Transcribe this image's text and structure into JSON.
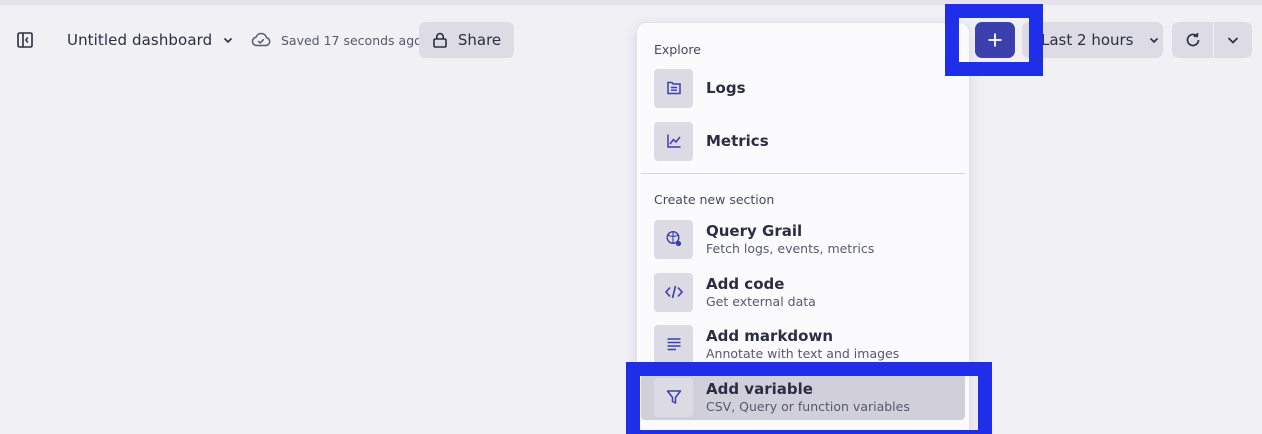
{
  "header": {
    "title": "Untitled dashboard",
    "saved_status": "Saved 17 seconds ago",
    "share_label": "Share",
    "timeframe_label": "Last 2 hours",
    "icons": {
      "sidebar_toggle": "sidebar-toggle-icon",
      "title_chevron": "chevron-down-icon",
      "saved": "cloud-check-icon",
      "share": "lock-icon",
      "add": "plus-icon",
      "timeframe_chevron": "chevron-down-icon",
      "refresh": "refresh-icon",
      "refresh_menu": "chevron-down-icon"
    }
  },
  "menu": {
    "explore_title": "Explore",
    "explore_items": [
      {
        "label": "Logs",
        "icon": "logs-icon"
      },
      {
        "label": "Metrics",
        "icon": "metrics-icon"
      }
    ],
    "create_title": "Create new section",
    "create_items": [
      {
        "label": "Query Grail",
        "sub": "Fetch logs, events, metrics",
        "icon": "query-grail-icon"
      },
      {
        "label": "Add code",
        "sub": "Get external data",
        "icon": "code-icon"
      },
      {
        "label": "Add markdown",
        "sub": "Annotate with text and images",
        "icon": "markdown-icon"
      },
      {
        "label": "Add variable",
        "sub": "CSV, Query or function variables",
        "icon": "filter-icon",
        "selected": true
      }
    ]
  },
  "colors": {
    "accent": "#3c3fae",
    "highlight": "#1f2ee8",
    "background": "#f1f0f5",
    "button_bg": "#dddce4"
  }
}
